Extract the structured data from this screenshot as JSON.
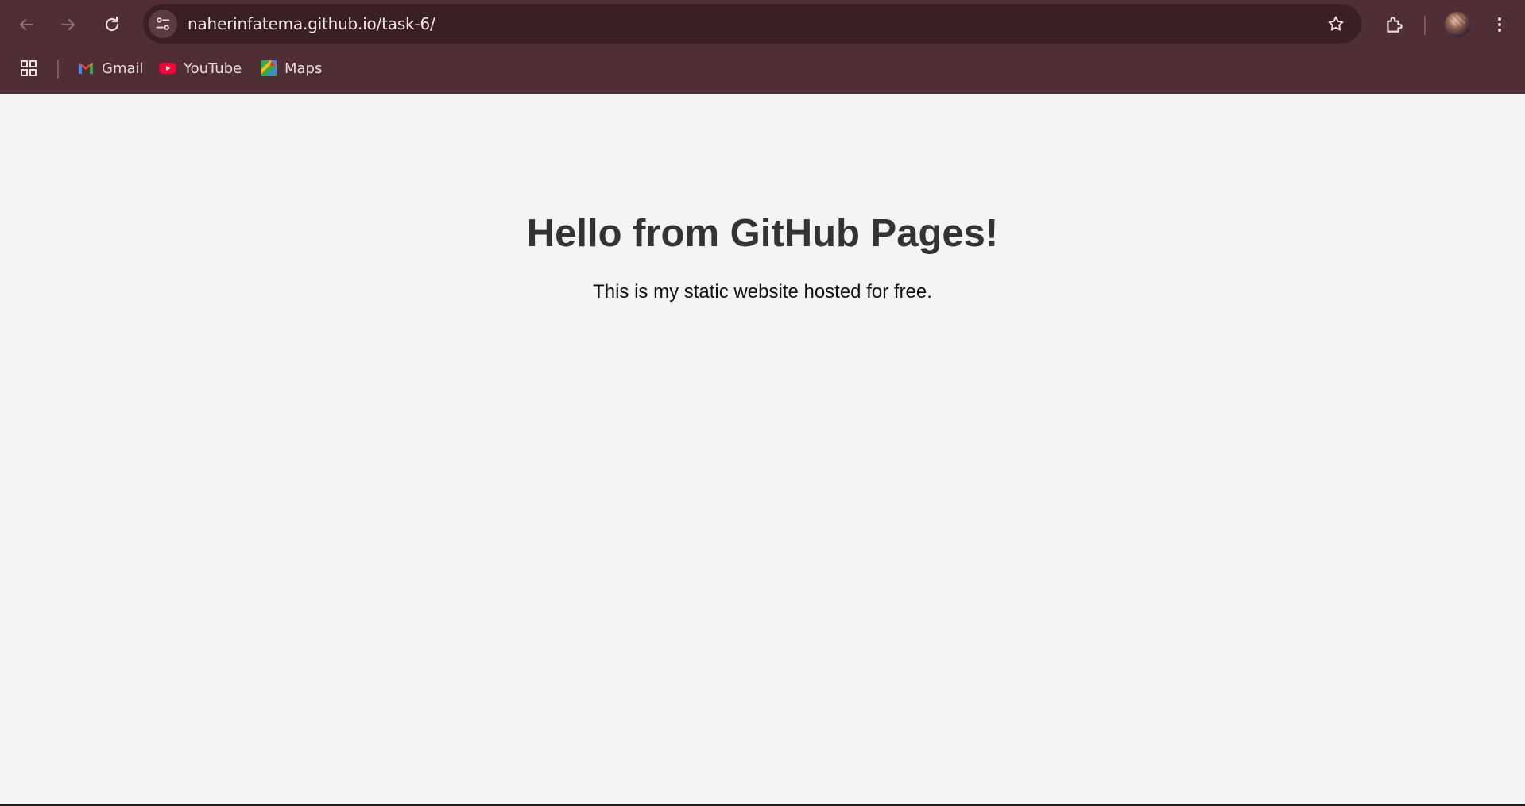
{
  "browser": {
    "url": "naherinfatema.github.io/task-6/",
    "colors": {
      "chrome": "#4f2f35",
      "omnibox": "#3a1f24",
      "page_background": "#f4f4f4"
    },
    "toolbar": {
      "back_icon": "arrow-left-icon",
      "forward_icon": "arrow-right-icon",
      "reload_icon": "reload-icon",
      "site_info_icon": "tune-icon",
      "bookmark_star_icon": "star-icon",
      "extensions_icon": "puzzle-icon",
      "menu_icon": "kebab-menu-icon"
    },
    "bookmarks": [
      {
        "label": "Gmail",
        "icon": "gmail-icon"
      },
      {
        "label": "YouTube",
        "icon": "youtube-icon"
      },
      {
        "label": "Maps",
        "icon": "maps-icon"
      }
    ]
  },
  "page": {
    "heading": "Hello from GitHub Pages!",
    "text": "This is my static website hosted for free."
  }
}
